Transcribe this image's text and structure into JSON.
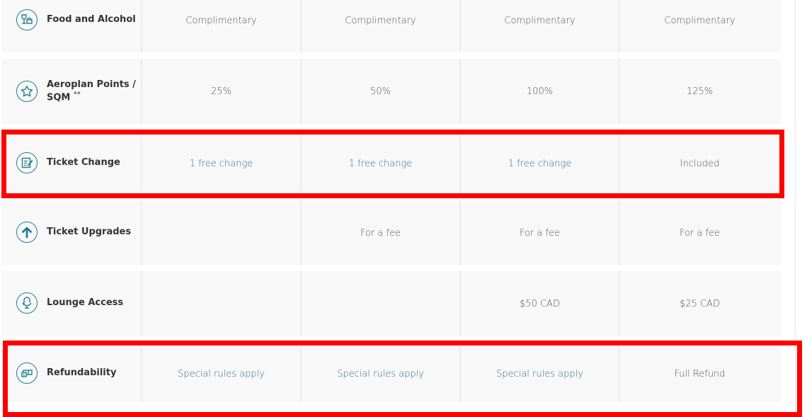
{
  "rows": [
    {
      "label": "Food and Alcohol",
      "icon": "food-alcohol-icon",
      "values": [
        "Complimentary",
        "Complimentary",
        "Complimentary",
        "Complimentary"
      ],
      "links": [
        false,
        false,
        false,
        false
      ]
    },
    {
      "label": "Aeroplan Points / SQM",
      "footnote": "**",
      "icon": "star-icon",
      "values": [
        "25%",
        "50%",
        "100%",
        "125%"
      ],
      "links": [
        false,
        false,
        false,
        false
      ]
    },
    {
      "label": "Ticket Change",
      "icon": "ticket-change-icon",
      "values": [
        "1 free change",
        "1 free change",
        "1 free change",
        "Included"
      ],
      "links": [
        true,
        true,
        true,
        false
      ]
    },
    {
      "label": "Ticket Upgrades",
      "icon": "arrow-up-icon",
      "values": [
        "",
        "For a fee",
        "For a fee",
        "For a fee"
      ],
      "links": [
        false,
        false,
        false,
        false
      ]
    },
    {
      "label": "Lounge Access",
      "icon": "lounge-chair-icon",
      "values": [
        "",
        "",
        "$50 CAD",
        "$25 CAD"
      ],
      "links": [
        false,
        false,
        false,
        false
      ]
    },
    {
      "label": "Refundability",
      "icon": "refund-money-icon",
      "values": [
        "Special rules apply",
        "Special rules apply",
        "Special rules apply",
        "Full Refund"
      ],
      "links": [
        true,
        true,
        true,
        false
      ]
    }
  ],
  "colors": {
    "accent": "#1f7f93",
    "link": "#2a6f97",
    "highlight": "#ff0000",
    "row_bg": "#f8f8f8"
  }
}
